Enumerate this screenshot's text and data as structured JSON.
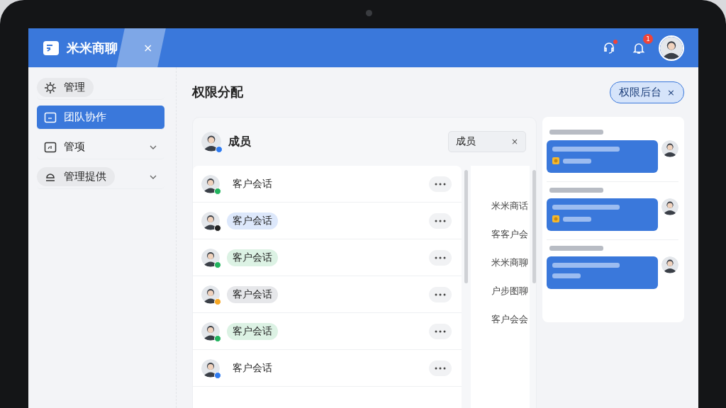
{
  "app": {
    "title": "米米商聊",
    "close": "×"
  },
  "header": {
    "support_unread": true,
    "notification_badge": "1"
  },
  "sidebar": {
    "items": [
      {
        "label": "管理",
        "selected": false,
        "pill": true,
        "expandable": false
      },
      {
        "label": "团队协作",
        "selected": true,
        "pill": false,
        "expandable": false
      },
      {
        "label": "管项",
        "selected": false,
        "pill": false,
        "expandable": true
      },
      {
        "label": "管理提供",
        "selected": false,
        "pill": true,
        "expandable": true
      }
    ]
  },
  "page": {
    "title": "权限分配",
    "action": {
      "label": "权限后台",
      "close": "×"
    }
  },
  "members": {
    "title": "成员",
    "color": "#2f7bf0",
    "filter": {
      "value": "成员",
      "close": "×"
    },
    "rows": [
      {
        "label": "客户会话",
        "color": "#22b35e"
      },
      {
        "label": "客户会话",
        "color": "#222222",
        "tag": {
          "color": "#dde8fb"
        }
      },
      {
        "label": "客户会话",
        "color": "#22b35e",
        "tag": {
          "color": "#dcf2e4"
        }
      },
      {
        "label": "客户会话",
        "color": "#f5a623",
        "tag": {
          "color": "#e6e7ea"
        }
      },
      {
        "label": "客户会话",
        "color": "#22b35e",
        "tag": {
          "color": "#dcf2e4"
        }
      },
      {
        "label": "客户会话",
        "color": "#2f7bf0"
      }
    ],
    "side_labels": [
      "米米商话",
      "客客户会",
      "米米商聊",
      "户步图聊",
      "客户会会"
    ]
  },
  "chat": {
    "messages": [
      {
        "attachment": true
      },
      {
        "attachment": true
      },
      {
        "attachment": false
      }
    ]
  }
}
